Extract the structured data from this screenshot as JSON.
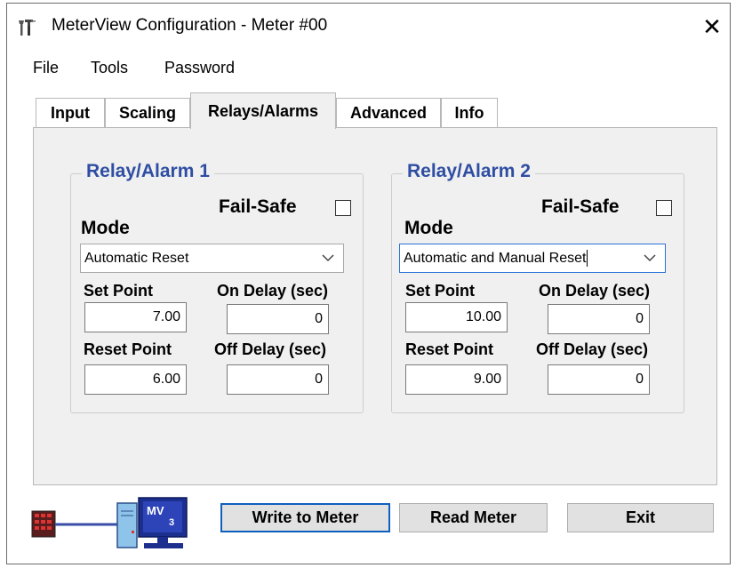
{
  "window": {
    "title": "MeterView Configuration - Meter #00",
    "close_glyph": "✕"
  },
  "menu": [
    "File",
    "Tools",
    "Password"
  ],
  "tabs": [
    {
      "label": "Input",
      "active": false
    },
    {
      "label": "Scaling",
      "active": false
    },
    {
      "label": "Relays/Alarms",
      "active": true
    },
    {
      "label": "Advanced",
      "active": false
    },
    {
      "label": "Info",
      "active": false
    }
  ],
  "relays": [
    {
      "title": "Relay/Alarm 1",
      "failsafe_label": "Fail-Safe",
      "failsafe_checked": false,
      "mode_label": "Mode",
      "mode_value": "Automatic Reset",
      "set_point_label": "Set Point",
      "set_point": "7.00",
      "on_delay_label": "On Delay (sec)",
      "on_delay": "0",
      "reset_point_label": "Reset Point",
      "reset_point": "6.00",
      "off_delay_label": "Off Delay (sec)",
      "off_delay": "0"
    },
    {
      "title": "Relay/Alarm 2",
      "failsafe_label": "Fail-Safe",
      "failsafe_checked": false,
      "mode_label": "Mode",
      "mode_value": "Automatic and Manual Reset",
      "set_point_label": "Set Point",
      "set_point": "10.00",
      "on_delay_label": "On Delay (sec)",
      "on_delay": "0",
      "reset_point_label": "Reset Point",
      "reset_point": "9.00",
      "off_delay_label": "Off Delay (sec)",
      "off_delay": "0"
    }
  ],
  "footer": {
    "logo_text": "MV3",
    "write_label": "Write to Meter",
    "read_label": "Read Meter",
    "exit_label": "Exit"
  },
  "colors": {
    "group_title": "#2f4ea3",
    "focus_border": "#2b73d6",
    "default_button_border": "#0f5fbd",
    "panel_bg": "#f0f0f0",
    "button_bg": "#e1e1e1"
  },
  "icons": {
    "app": "tools-icon",
    "footer": "meter-computer-link-icon",
    "close": "close-icon",
    "dropdown": "chevron-down-icon"
  }
}
